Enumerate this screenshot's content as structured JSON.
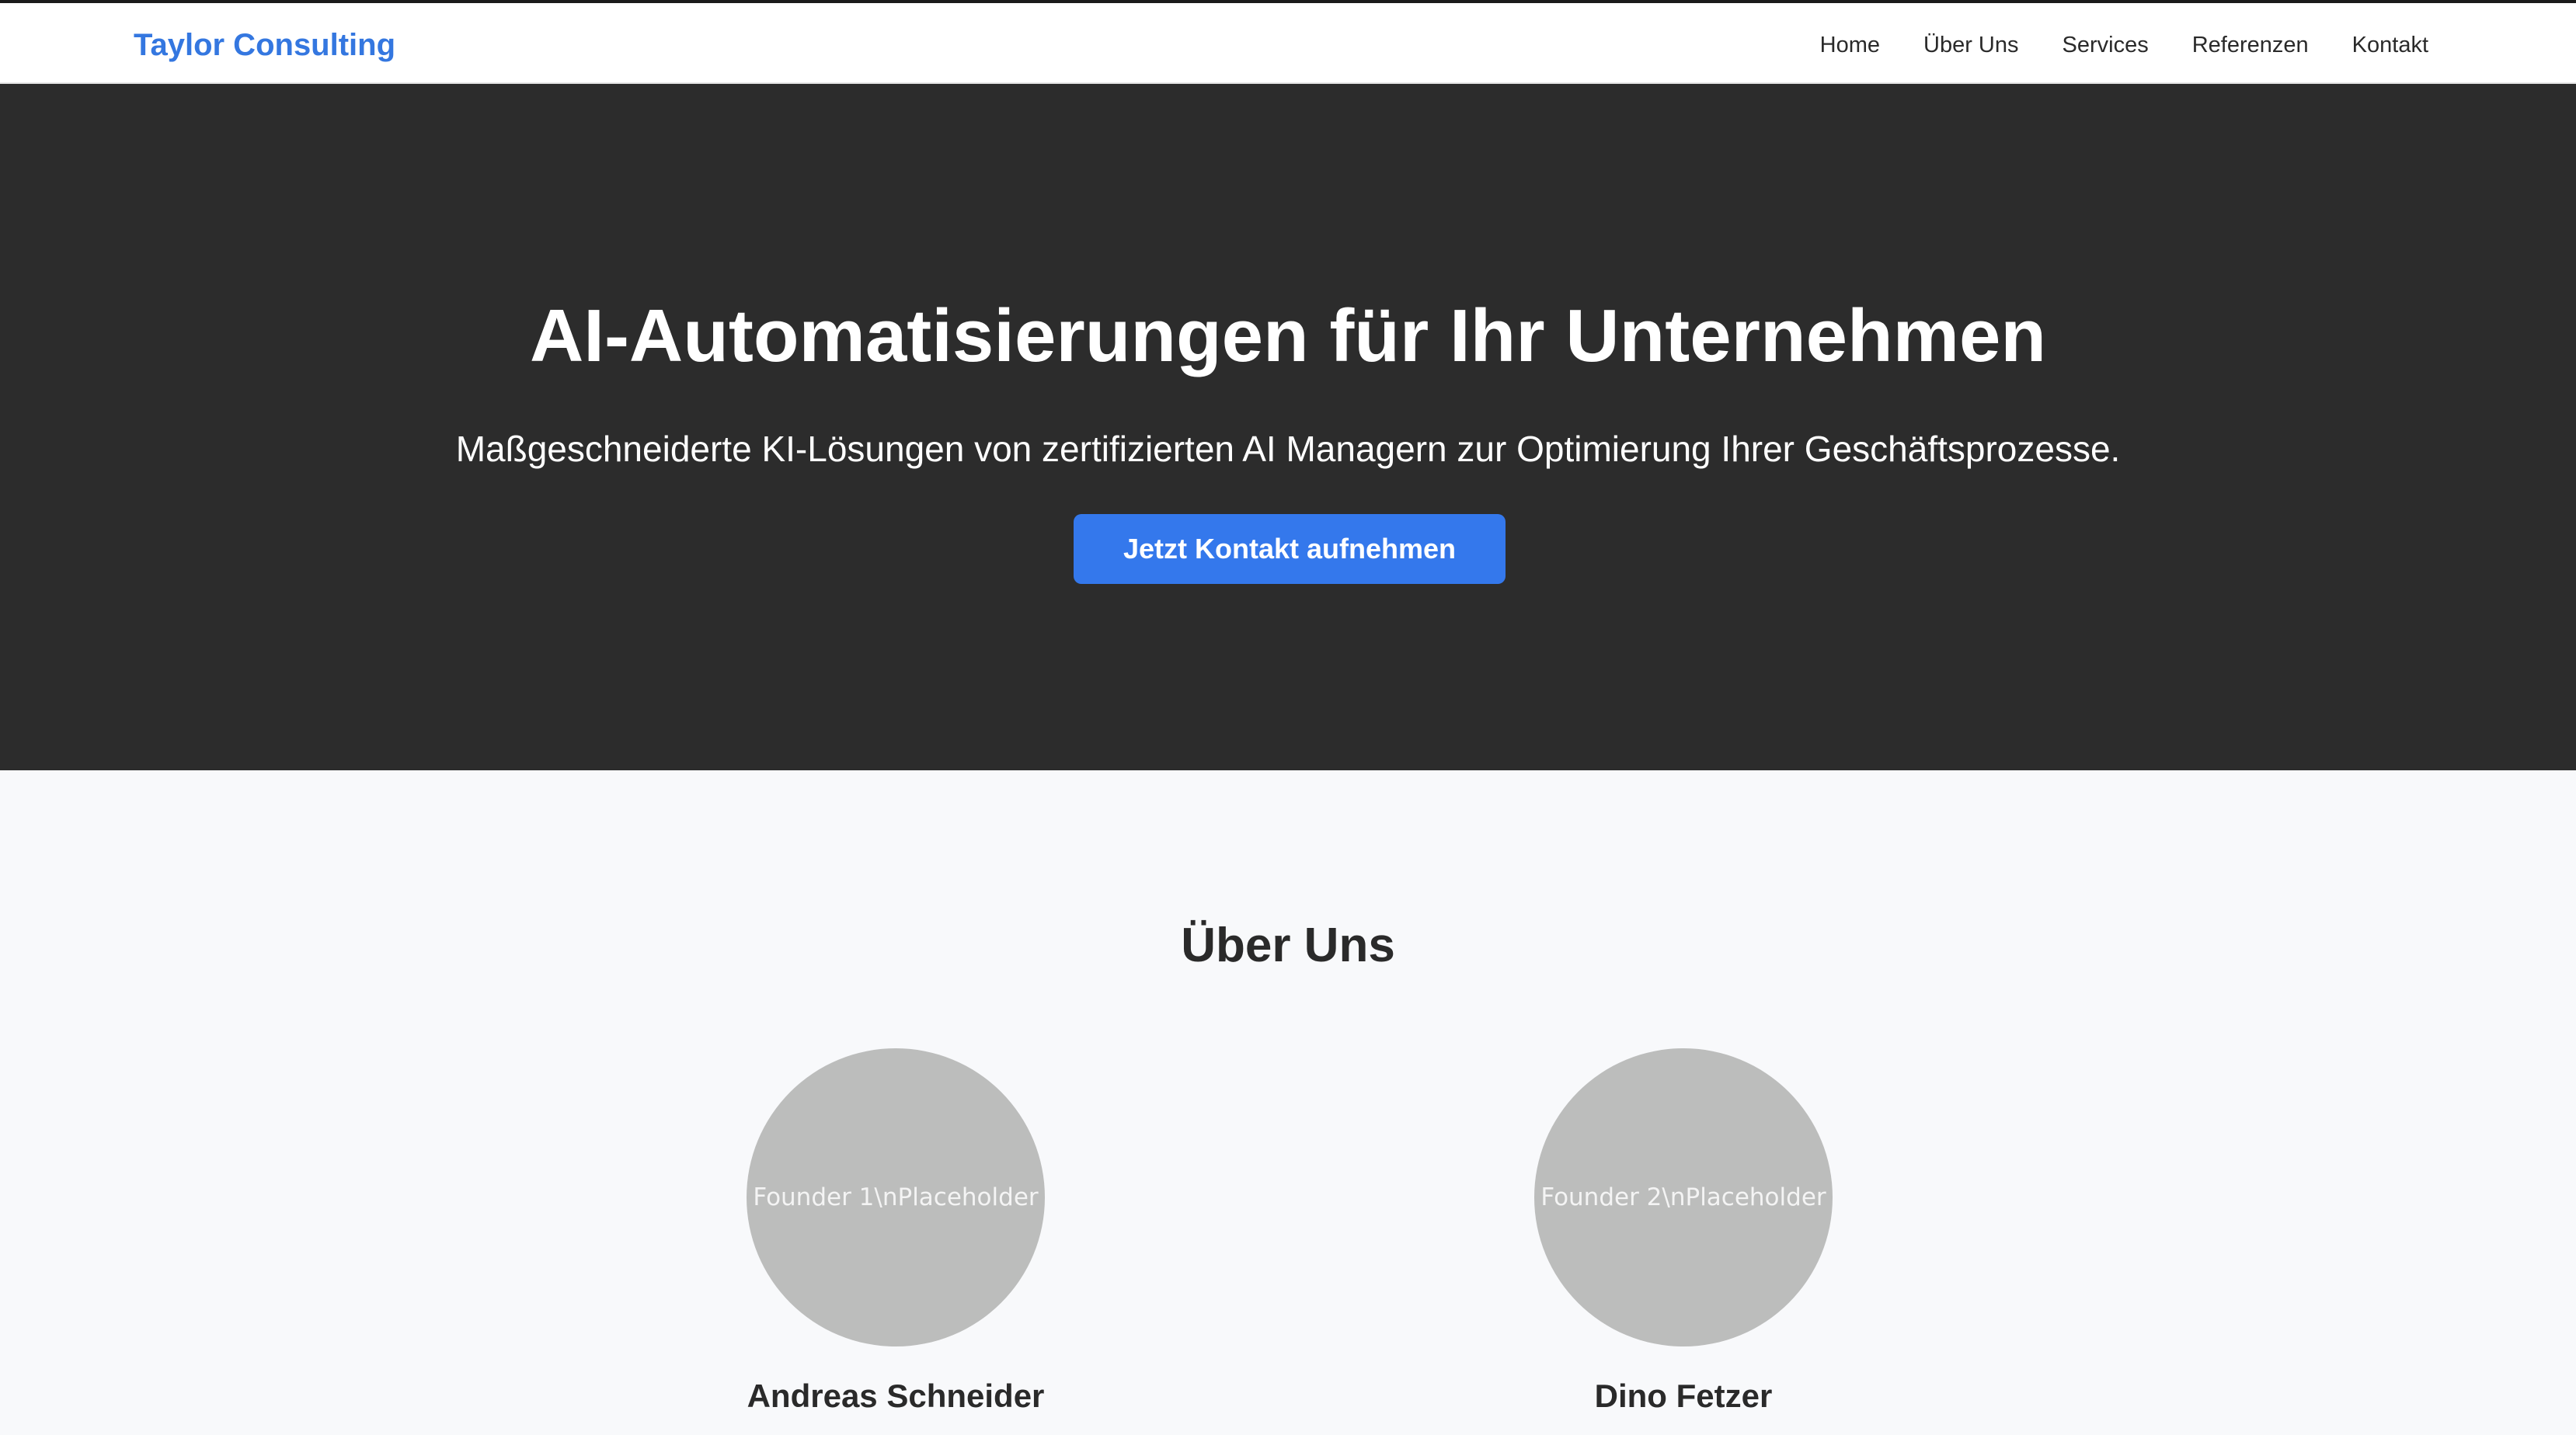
{
  "header": {
    "brand": "Taylor Consulting",
    "nav": [
      "Home",
      "Über Uns",
      "Services",
      "Referenzen",
      "Kontakt"
    ]
  },
  "hero": {
    "title": "AI-Automatisierungen für Ihr Unternehmen",
    "subtitle": "Maßgeschneiderte KI-Lösungen von zertifizierten AI Managern zur Optimierung Ihrer Geschäftsprozesse.",
    "cta_label": "Jetzt Kontakt aufnehmen"
  },
  "about": {
    "title": "Über Uns",
    "founders": [
      {
        "photo_placeholder": "Founder 1\\nPlaceholder",
        "name": "Andreas Schneider",
        "description": ""
      },
      {
        "photo_placeholder": "Founder 2\\nPlaceholder",
        "name": "Dino Fetzer",
        "description": ""
      }
    ]
  },
  "colors": {
    "brand": "#3477e0",
    "hero_bg": "#2c2c2c",
    "cta_bg": "#3478ec",
    "section_bg": "#f8f9fb",
    "photo_placeholder_bg": "#bcbdbc"
  }
}
